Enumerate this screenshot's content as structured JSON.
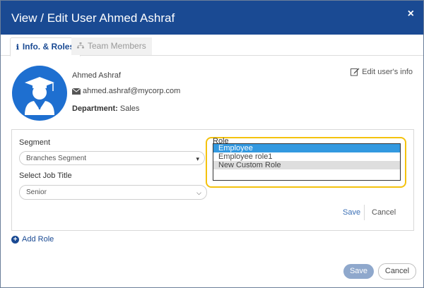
{
  "dialog": {
    "title": "View / Edit User Ahmed Ashraf",
    "close_label": "×"
  },
  "tabs": [
    {
      "label": "Info. & Roles",
      "icon": "info-icon",
      "active": true
    },
    {
      "label": "Team Members",
      "icon": "sitemap-icon",
      "active": false
    }
  ],
  "user": {
    "name": "Ahmed Ashraf",
    "email": "ahmed.ashraf@mycorp.com",
    "department_label": "Department:",
    "department_value": "Sales",
    "edit_label": "Edit user's info"
  },
  "role_form": {
    "segment_label": "Segment",
    "segment_value": "Branches Segment",
    "job_title_label": "Select Job Title",
    "job_title_value": "Senior",
    "role_label": "Role",
    "role_options": [
      "Employee",
      "Employee role1",
      "New Custom Role"
    ],
    "selected_role": "Employee",
    "save_label": "Save",
    "cancel_label": "Cancel"
  },
  "add_role_label": "Add Role",
  "footer": {
    "save_label": "Save",
    "cancel_label": "Cancel"
  },
  "colors": {
    "header": "#1a4a93",
    "avatar": "#1e6fd0",
    "selected_option": "#3399e0",
    "highlight_ring": "#f4c20d"
  }
}
